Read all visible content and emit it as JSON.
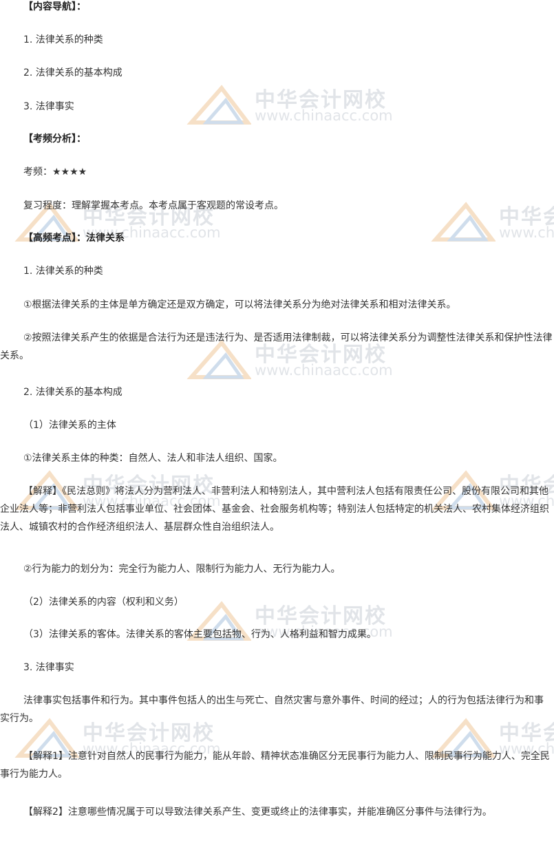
{
  "nav": {
    "heading": "【内容导航】：",
    "items": [
      "1. 法律关系的种类",
      "2. 法律关系的基本构成",
      "3. 法律事实"
    ]
  },
  "freq": {
    "heading": "【考频分析】：",
    "rating": "考频：★★★★",
    "review": "复习程度：理解掌握本考点。本考点属于客观题的常设考点。"
  },
  "topic": {
    "heading": "【高频考点】：法律关系",
    "s1_title": "1. 法律关系的种类",
    "s1_p1": "①根据法律关系的主体是单方确定还是双方确定，可以将法律关系分为绝对法律关系和相对法律关系。",
    "s1_p2": "②按照法律关系产生的依据是合法行为还是违法行为、是否适用法律制裁，可以将法律关系分为调整性法律关系和保护性法律关系。",
    "s2_title": "2. 法律关系的基本构成",
    "s2_sub1": "（1）法律关系的主体",
    "s2_p1": "①法律关系主体的种类：自然人、法人和非法人组织、国家。",
    "s2_explain": "【解释】《民法总则》将法人分为营利法人、非营利法人和特别法人，其中营利法人包括有限责任公司、股份有限公司和其他企业法人等；非营利法人包括事业单位、社会团体、基金会、社会服务机构等；特别法人包括特定的机关法人、农村集体经济组织法人、城镇农村的合作经济组织法人、基层群众性自治组织法人。",
    "s2_p2": "②行为能力的划分为：完全行为能力人、限制行为能力人、无行为能力人。",
    "s2_sub2": "（2）法律关系的内容（权利和义务）",
    "s2_sub3": "（3）法律关系的客体。法律关系的客体主要包括物、行为、人格利益和智力成果。",
    "s3_title": "3. 法律事实",
    "s3_p1": "法律事实包括事件和行为。其中事件包括人的出生与死亡、自然灾害与意外事件、时间的经过；人的行为包括法律行为和事实行为。",
    "s3_explain1": "【解释1】注意针对自然人的民事行为能力，能从年龄、精神状态准确区分无民事行为能力人、限制民事行为能力人、完全民事行为能力人。",
    "s3_explain2": "【解释2】注意哪些情况属于可以导致法律关系产生、变更或终止的法律事实，并能准确区分事件与法律行为。"
  },
  "watermark": {
    "cn": "中华会计网校",
    "en": "www.chinaacc.com"
  }
}
